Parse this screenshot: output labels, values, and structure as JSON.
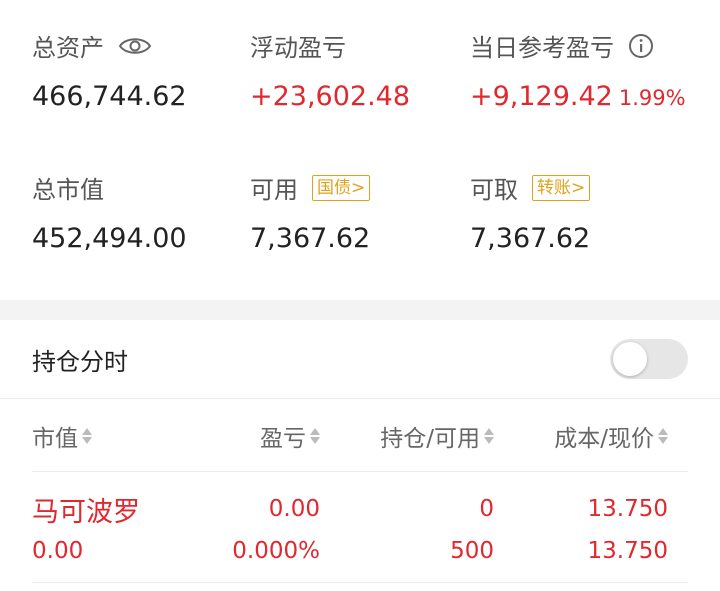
{
  "summary": {
    "total_assets": {
      "label": "总资产",
      "value": "466,744.62"
    },
    "floating_pl": {
      "label": "浮动盈亏",
      "value": "+23,602.48"
    },
    "daily_pl": {
      "label": "当日参考盈亏",
      "value": "+9,129.42",
      "percent": "1.99%"
    },
    "market_value": {
      "label": "总市值",
      "value": "452,494.00"
    },
    "available": {
      "label": "可用",
      "value": "7,367.62",
      "tag": "国债>"
    },
    "withdrawable": {
      "label": "可取",
      "value": "7,367.62",
      "tag": "转账>"
    }
  },
  "toggle": {
    "label": "持仓分时",
    "on": false
  },
  "table": {
    "headers": [
      "市值",
      "盈亏",
      "持仓/可用",
      "成本/现价"
    ],
    "rows": [
      {
        "name": "马可波罗",
        "market_value": "0.00",
        "pl": "0.00",
        "pl_pct": "0.000%",
        "position": "0",
        "available": "500",
        "cost": "13.750",
        "price": "13.750"
      }
    ]
  },
  "colors": {
    "up": "#e0282e",
    "tag": "#e0a21c"
  },
  "icons": [
    "eye-icon",
    "info-icon",
    "sort-icon"
  ]
}
